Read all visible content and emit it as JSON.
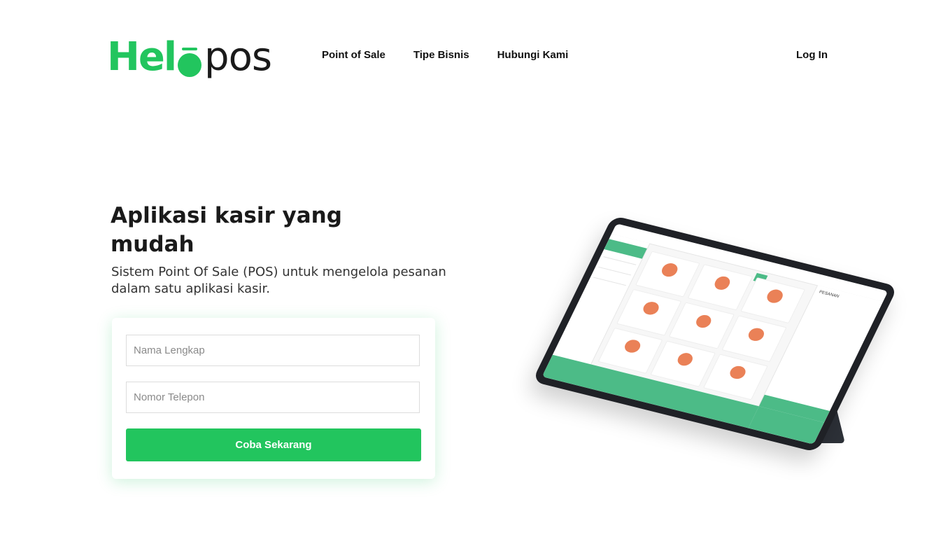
{
  "brand": {
    "logo_alt": "Helopos",
    "accent": "#22c55e"
  },
  "nav": {
    "items": [
      {
        "label": "Point of Sale"
      },
      {
        "label": "Tipe Bisnis"
      },
      {
        "label": "Hubungi Kami"
      }
    ],
    "login_label": "Log In"
  },
  "hero": {
    "title": "Aplikasi kasir yang mudah",
    "subtitle": "Sistem Point Of Sale (POS) untuk mengelola pesanan dalam satu aplikasi kasir."
  },
  "form": {
    "name_placeholder": "Nama Lengkap",
    "phone_placeholder": "Nomor Telepon",
    "submit_label": "Coba Sekarang"
  },
  "device_screen": {
    "order_panel_label": "PESANAN"
  }
}
